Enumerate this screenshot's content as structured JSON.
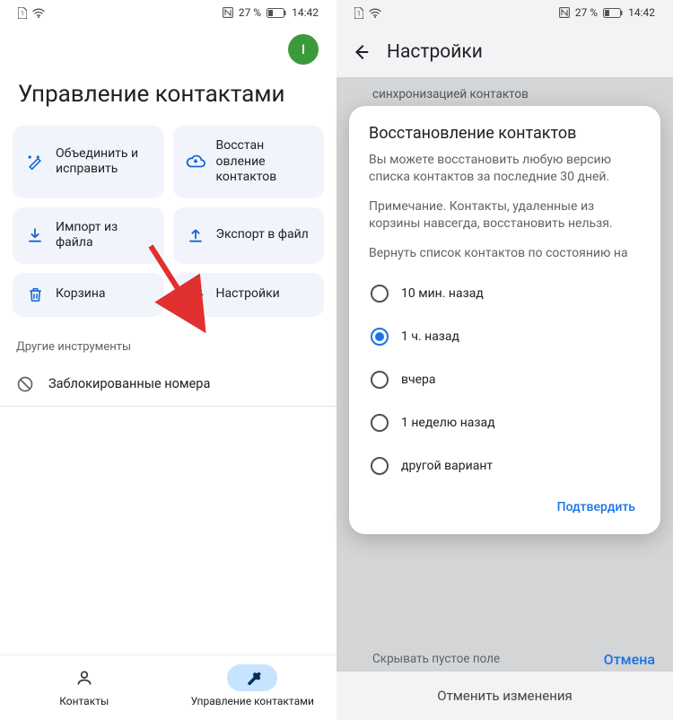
{
  "status": {
    "battery_pct": "27 %",
    "time": "14:42"
  },
  "left": {
    "avatar_letter": "I",
    "page_title": "Управление контактами",
    "cards": [
      {
        "id": "merge-fix",
        "label": "Объединить и исправить"
      },
      {
        "id": "restore",
        "label": "Восстан овление контактов"
      },
      {
        "id": "import",
        "label": "Импорт из файла"
      },
      {
        "id": "export",
        "label": "Экспорт в файл"
      },
      {
        "id": "trash",
        "label": "Корзина"
      },
      {
        "id": "settings",
        "label": "Настройки"
      }
    ],
    "section_other": "Другие инструменты",
    "blocked": "Заблокированные номера",
    "nav": {
      "contacts": "Контакты",
      "manage": "Управление контактами"
    }
  },
  "right": {
    "header_title": "Настройки",
    "bg_faint_line2": "синхронизацией контактов",
    "bg_hidden_row": "Скрывать пустое поле",
    "bg_cancel": "Отмена",
    "bg_undo": "Отменить изменения",
    "dialog": {
      "title": "Восстановление контактов",
      "p1": "Вы можете восстановить любую версию списка контактов за последние 30 дней.",
      "p2": "Примечание. Контакты, удаленные из корзины навсегда, восстановить нельзя.",
      "p3": "Вернуть список контактов по состоянию на",
      "options": [
        {
          "id": "10min",
          "label": "10 мин. назад",
          "checked": false
        },
        {
          "id": "1h",
          "label": "1 ч. назад",
          "checked": true
        },
        {
          "id": "yday",
          "label": "вчера",
          "checked": false
        },
        {
          "id": "1w",
          "label": "1 неделю назад",
          "checked": false
        },
        {
          "id": "other",
          "label": "другой вариант",
          "checked": false
        }
      ],
      "confirm": "Подтвердить"
    }
  }
}
